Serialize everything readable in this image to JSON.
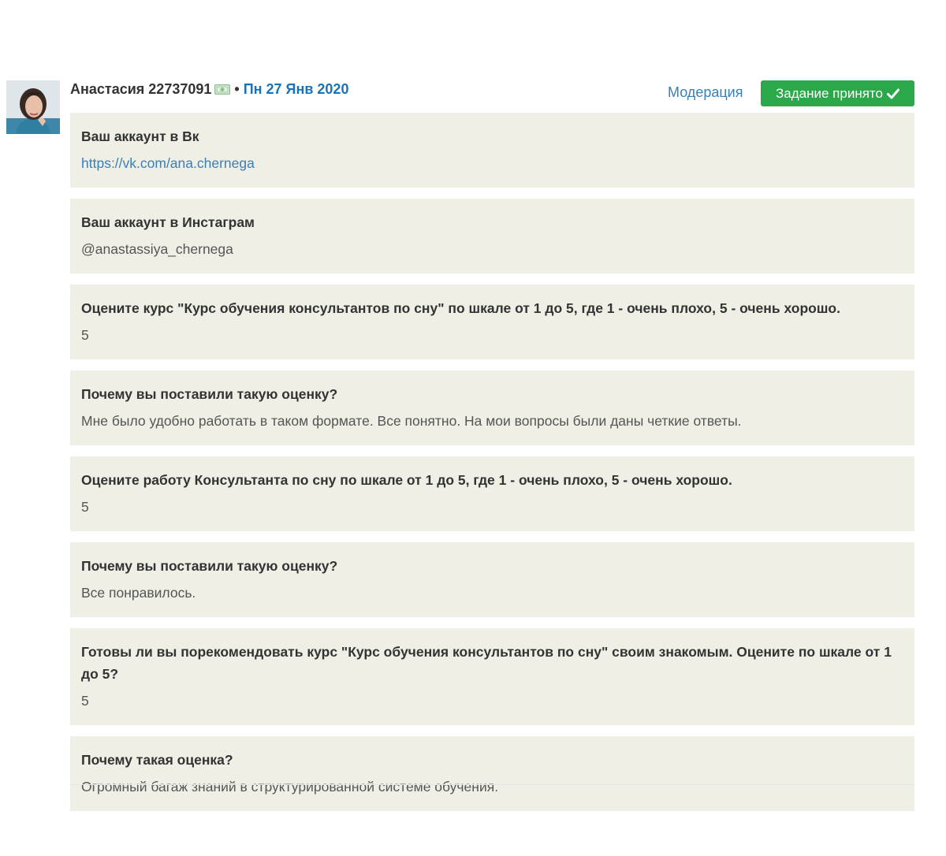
{
  "header": {
    "author_name": "Анастасия 22737091",
    "separator": "•",
    "date": "Пн 27 Янв 2020",
    "moderation_label": "Модерация",
    "status_label": "Задание принято"
  },
  "answers": [
    {
      "question": "Ваш аккаунт в Вк",
      "answer": "https://vk.com/ana.chernega"
    },
    {
      "question": "Ваш аккаунт в Инстаграм",
      "answer": "@anastassiya_chernega"
    },
    {
      "question": "Оцените курс \"Курс обучения консультантов по сну\" по шкале от 1 до 5, где 1 - очень плохо, 5 - очень хорошо.",
      "answer": "5"
    },
    {
      "question": "Почему вы поставили такую оценку?",
      "answer": "Мне было удобно работать в таком формате. Все понятно. На мои вопросы были даны четкие ответы."
    },
    {
      "question": "Оцените работу Консультанта по сну по шкале от 1 до 5, где 1 - очень плохо, 5 - очень хорошо.",
      "answer": "5"
    },
    {
      "question": "Почему вы поставили такую оценку?",
      "answer": "Все понравилось."
    },
    {
      "question": "Готовы ли вы порекомендовать курс \"Курс обучения консультантов по сну\" своим знакомым. Оцените по шкале от 1 до 5?",
      "answer": "5"
    },
    {
      "question": "Почему такая оценка?",
      "answer": "Огромный багаж знаний в структурированной системе обучения."
    }
  ],
  "colors": {
    "block_background": "#efefe6",
    "accent_link": "#3a7fb5",
    "date_blue": "#1a73b8",
    "status_green": "#2ba84a"
  },
  "icons": {
    "money": "money-icon",
    "check": "check-icon"
  }
}
